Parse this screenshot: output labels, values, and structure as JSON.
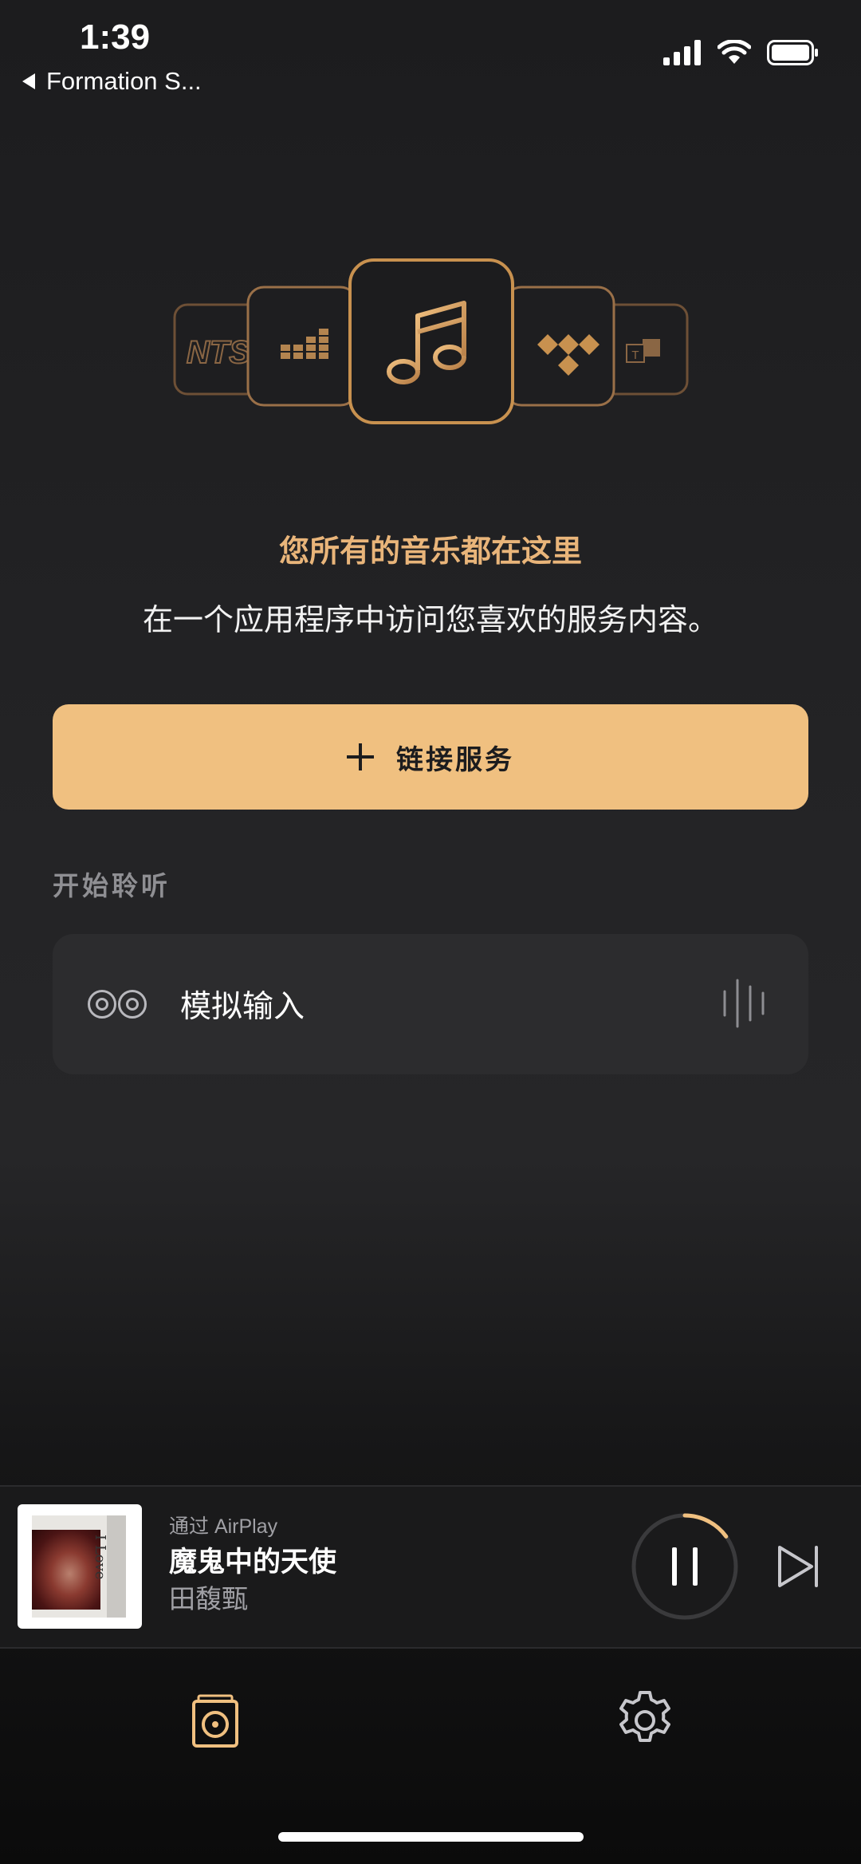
{
  "status_bar": {
    "time": "1:39",
    "back_label": "Formation S..."
  },
  "hero": {
    "icons": [
      "nts-icon",
      "deezer-icon",
      "music-note-icon",
      "tidal-icon",
      "tunein-icon"
    ],
    "nts_text": "NTS",
    "tunein_text": "T"
  },
  "headline": "您所有的音乐都在这里",
  "subline": "在一个应用程序中访问您喜欢的服务内容。",
  "connect_button": {
    "label": "链接服务",
    "icon": "plus-icon"
  },
  "section_label": "开始聆听",
  "input_card": {
    "label": "模拟输入",
    "icon": "analog-input-icon"
  },
  "mini_player": {
    "via": "通过 AirPlay",
    "title": "魔鬼中的天使",
    "artist": "田馥甄",
    "album_text": "I Love",
    "progress": 0.15
  },
  "tabs": [
    {
      "name": "home",
      "icon": "speaker-icon",
      "active": true
    },
    {
      "name": "settings",
      "icon": "gear-icon",
      "active": false
    }
  ],
  "colors": {
    "accent": "#f0c080",
    "accent_dark": "#c8914f",
    "icon_outline": "#7b5a3a",
    "headline": "#e9b57a"
  }
}
